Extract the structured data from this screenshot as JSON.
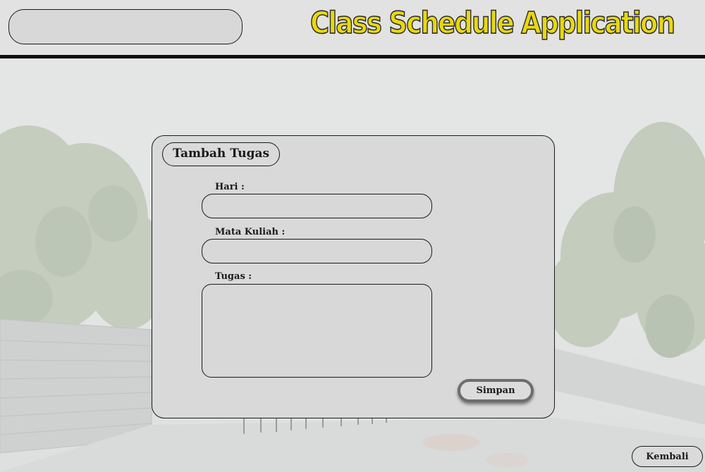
{
  "header": {
    "title": "Class Schedule Application",
    "search_value": "",
    "title_color": "#e8d80f"
  },
  "dialog": {
    "title": "Tambah Tugas",
    "fields": [
      {
        "label": "Hari :",
        "value": ""
      },
      {
        "label": "Mata Kuliah :",
        "value": ""
      },
      {
        "label": "Tugas :",
        "value": ""
      }
    ],
    "save_label": "Simpan"
  },
  "footer": {
    "back_label": "Kembali"
  },
  "background": {
    "description_icon": "courtyard-photo"
  }
}
